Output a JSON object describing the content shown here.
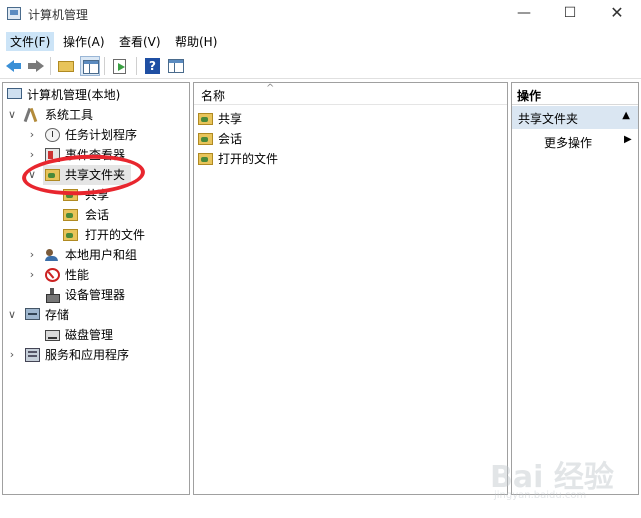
{
  "window": {
    "title": "计算机管理"
  },
  "window_controls": {
    "minimize": "—",
    "maximize": "☐",
    "close": "✕"
  },
  "menu": [
    "文件(F)",
    "操作(A)",
    "查看(V)",
    "帮助(H)"
  ],
  "toolbar": {
    "help_glyph": "?"
  },
  "tree": [
    {
      "label": "计算机管理(本地)",
      "chevron": "",
      "icon": "computer-icon"
    },
    {
      "label": "系统工具",
      "chevron": "∨",
      "icon": "tools-icon"
    },
    {
      "label": "任务计划程序",
      "chevron": "›",
      "icon": "clock-icon"
    },
    {
      "label": "事件查看器",
      "chevron": "›",
      "icon": "event-viewer-icon"
    },
    {
      "label": "共享文件夹",
      "chevron": "∨",
      "icon": "shared-folder-icon",
      "selected": true
    },
    {
      "label": "共享",
      "chevron": "",
      "icon": "shared-folder-icon"
    },
    {
      "label": "会话",
      "chevron": "",
      "icon": "shared-folder-icon"
    },
    {
      "label": "打开的文件",
      "chevron": "",
      "icon": "shared-folder-icon"
    },
    {
      "label": "本地用户和组",
      "chevron": "›",
      "icon": "users-icon"
    },
    {
      "label": "性能",
      "chevron": "›",
      "icon": "performance-icon"
    },
    {
      "label": "设备管理器",
      "chevron": "",
      "icon": "device-manager-icon"
    },
    {
      "label": "存储",
      "chevron": "∨",
      "icon": "storage-icon"
    },
    {
      "label": "磁盘管理",
      "chevron": "",
      "icon": "disk-icon"
    },
    {
      "label": "服务和应用程序",
      "chevron": "›",
      "icon": "services-icon"
    }
  ],
  "list": {
    "column_header": "名称",
    "sort_indicator": "^",
    "items": [
      "共享",
      "会话",
      "打开的文件"
    ]
  },
  "actions": {
    "header": "操作",
    "section": "共享文件夹",
    "section_glyph": "▲",
    "more": "更多操作",
    "more_glyph": "▶"
  },
  "watermark": {
    "text": "Bai 经验",
    "url": "jingyan.baidu.com"
  },
  "colors": {
    "annotation": "#e8262e",
    "action_section": "#dae6f2",
    "selected_row": "#e5e5e5"
  }
}
